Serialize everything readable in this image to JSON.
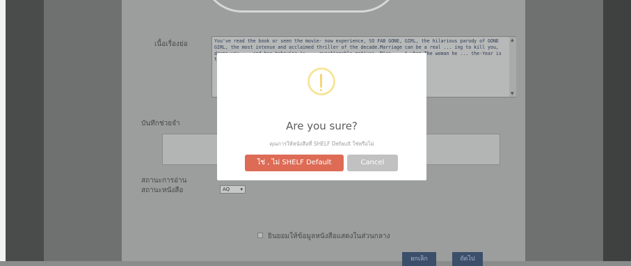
{
  "form": {
    "description_label": "เนื้อเรื่องย่อ",
    "description_text": "You've read the book or seen the movie- now experience, SO FAB GONE, GIRL, the hilarious parody of GONE GIRL, the most intense and acclaimed thriller of the decade.Marriage can be a real ... ing to kill you, drama you ... and her behavior is ... questionable motives. Mira ... t when The woman he ... the-Year is truly ... ic questions or inane",
    "note_label": "บันทึกช่วยจำ",
    "reading_status_label": "สถานะการอ่าน",
    "book_status_label": "สถานะหนังสือ",
    "book_status_value": "AQ",
    "consent_label": "ยินยอมให้ข้อมูลหนังสือแสดงในส่วนกลาง",
    "cancel_button": "ยกเลิก",
    "next_button": "ถัดไป"
  },
  "modal": {
    "title": "Are you sure?",
    "message": "คุณการให้หนังสือที่ SHELF Default ใช่หรือไม่",
    "confirm_label": "ใช่ , ไม่ SHELF Default",
    "cancel_label": "Cancel",
    "icon": "warning-icon",
    "confirm_color": "#dd6b55",
    "cancel_color": "#c1c1c1"
  }
}
